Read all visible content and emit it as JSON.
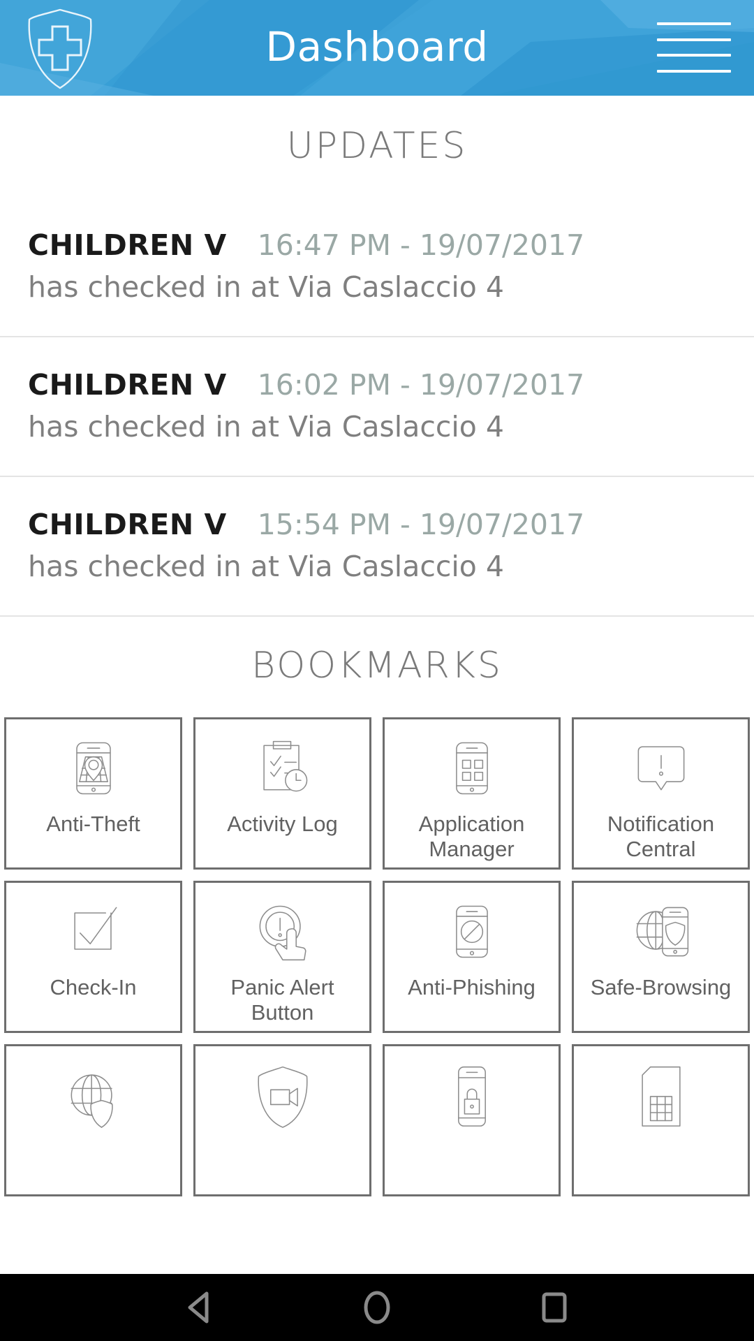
{
  "header": {
    "title": "Dashboard",
    "logo_icon": "shield-cross-icon",
    "menu_icon": "hamburger-menu-icon",
    "background_color": "#389fd6"
  },
  "updates": {
    "section_title": "UPDATES",
    "items": [
      {
        "name": "CHILDREN V",
        "time": "16:47 PM - 19/07/2017",
        "text": "has checked in at Via Caslaccio 4"
      },
      {
        "name": "CHILDREN V",
        "time": "16:02 PM - 19/07/2017",
        "text": "has checked in at Via Caslaccio 4"
      },
      {
        "name": "CHILDREN V",
        "time": "15:54 PM - 19/07/2017",
        "text": "has checked in at Via Caslaccio 4"
      }
    ]
  },
  "bookmarks": {
    "section_title": "BOOKMARKS",
    "tiles": [
      {
        "label": "Anti-Theft",
        "icon": "phone-map-pin-icon"
      },
      {
        "label": "Activity Log",
        "icon": "clipboard-clock-icon"
      },
      {
        "label": "Application Manager",
        "icon": "phone-app-grid-icon"
      },
      {
        "label": "Notification Central",
        "icon": "speech-bubble-alert-icon"
      },
      {
        "label": "Check-In",
        "icon": "checkbox-check-icon"
      },
      {
        "label": "Panic Alert Button",
        "icon": "panic-button-hand-icon"
      },
      {
        "label": "Anti-Phishing",
        "icon": "phone-block-icon"
      },
      {
        "label": "Safe-Browsing",
        "icon": "globe-phone-shield-icon"
      },
      {
        "label": "",
        "icon": "globe-shield-icon"
      },
      {
        "label": "",
        "icon": "shield-camera-icon"
      },
      {
        "label": "",
        "icon": "phone-lock-icon"
      },
      {
        "label": "",
        "icon": "sim-card-icon"
      }
    ]
  },
  "nav_bar": {
    "back_icon": "back-triangle-icon",
    "home_icon": "home-circle-icon",
    "recents_icon": "recents-square-icon"
  }
}
